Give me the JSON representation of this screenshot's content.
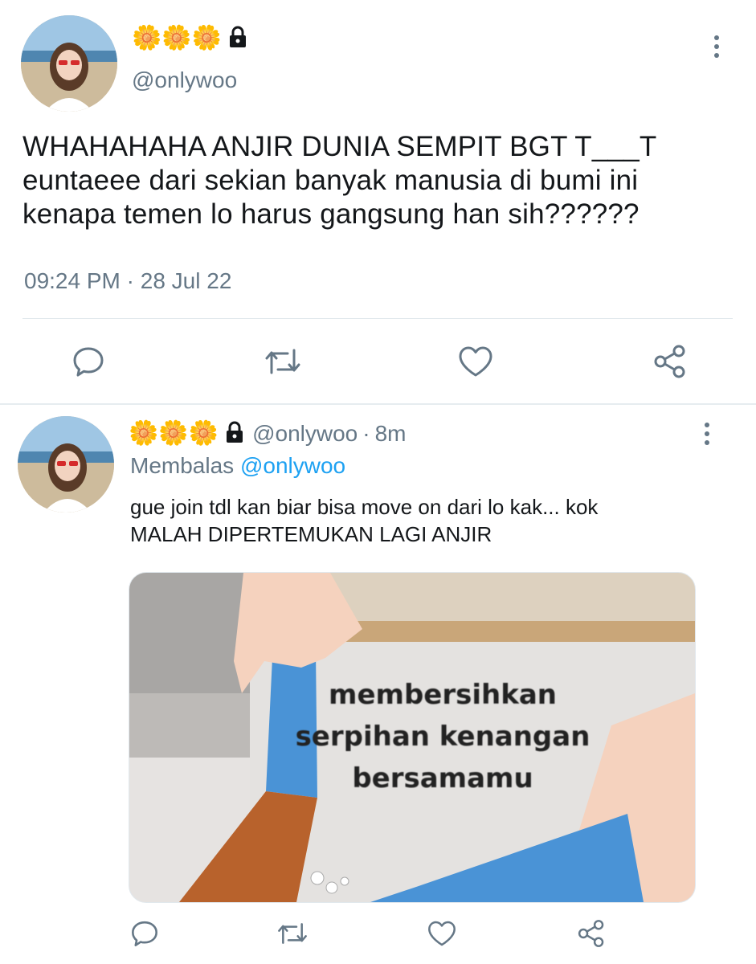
{
  "main_tweet": {
    "display_name_emojis": [
      "🌼",
      "🌼",
      "🌼"
    ],
    "handle": "@onlywoo",
    "text_lines": [
      "WHAHAHAHA ANJIR DUNIA SEMPIT BGT T___T",
      "euntaeee dari sekian banyak manusia di bumi ini",
      "kenapa temen lo harus gangsung han sih??????"
    ],
    "time": "09:24 PM",
    "separator": "·",
    "date": "28 Jul 22"
  },
  "reply_tweet": {
    "display_name_emojis": [
      "🌼",
      "🌼",
      "🌼"
    ],
    "handle": "@onlywoo",
    "separator": "·",
    "age": "8m",
    "replying_label": "Membalas",
    "replying_to": "@onlywoo",
    "text_lines": [
      "gue join tdl kan biar bisa move on dari lo kak... kok",
      "MALAH DIPERTEMUKAN LAGI ANJIR"
    ],
    "media_caption_lines": [
      "membersihkan",
      "serpihan kenangan",
      "bersamamu"
    ]
  },
  "icons": {
    "verified_lock": "lock-icon",
    "more": "more-vertical-icon",
    "reply": "comment-icon",
    "retweet": "retweet-icon",
    "like": "heart-icon",
    "share": "share-icon"
  },
  "colors": {
    "text": "#14171a",
    "secondary": "#657786",
    "link": "#1da1f2",
    "divider": "#e1e8ed"
  }
}
